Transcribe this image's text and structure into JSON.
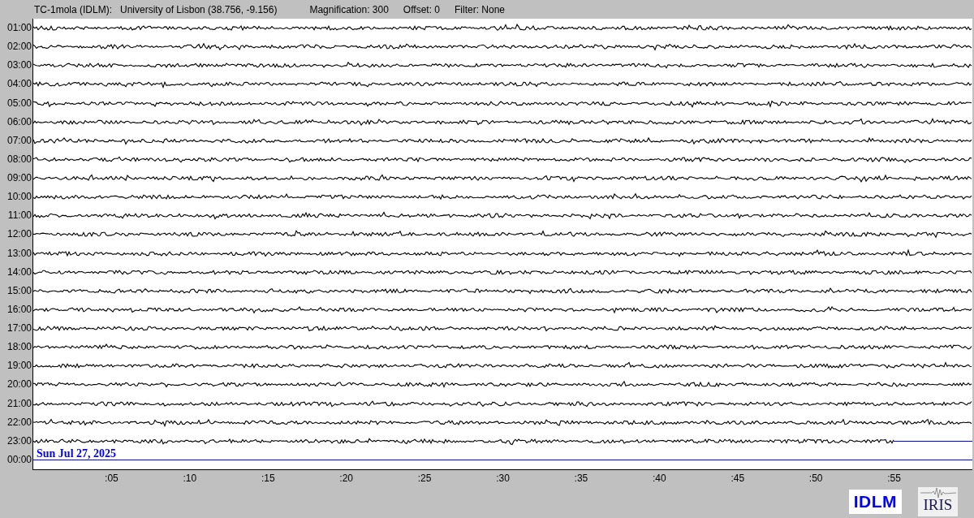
{
  "header": {
    "station": "TC-1mola (IDLM):",
    "location": "University of Lisbon (38.756, -9.156)",
    "magnification": "Magnification: 300",
    "offset": "Offset: 0",
    "filter": "Filter: None"
  },
  "rows": [
    {
      "label": "01:00",
      "kind": "full"
    },
    {
      "label": "02:00",
      "kind": "full"
    },
    {
      "label": "03:00",
      "kind": "full"
    },
    {
      "label": "04:00",
      "kind": "full"
    },
    {
      "label": "05:00",
      "kind": "full"
    },
    {
      "label": "06:00",
      "kind": "full"
    },
    {
      "label": "07:00",
      "kind": "full"
    },
    {
      "label": "08:00",
      "kind": "full"
    },
    {
      "label": "09:00",
      "kind": "full"
    },
    {
      "label": "10:00",
      "kind": "full"
    },
    {
      "label": "11:00",
      "kind": "full"
    },
    {
      "label": "12:00",
      "kind": "full"
    },
    {
      "label": "13:00",
      "kind": "full"
    },
    {
      "label": "14:00",
      "kind": "full"
    },
    {
      "label": "15:00",
      "kind": "full"
    },
    {
      "label": "16:00",
      "kind": "full"
    },
    {
      "label": "17:00",
      "kind": "full"
    },
    {
      "label": "18:00",
      "kind": "full"
    },
    {
      "label": "19:00",
      "kind": "full"
    },
    {
      "label": "20:00",
      "kind": "full"
    },
    {
      "label": "21:00",
      "kind": "full"
    },
    {
      "label": "22:00",
      "kind": "full"
    },
    {
      "label": "23:00",
      "kind": "partial"
    },
    {
      "label": "00:00",
      "kind": "empty"
    }
  ],
  "date_label": "Sun Jul 27, 2025",
  "x_ticks": [
    ":05",
    ":10",
    ":15",
    ":20",
    ":25",
    ":30",
    ":35",
    ":40",
    ":45",
    ":50",
    ":55"
  ],
  "logos": {
    "station": "IDLM",
    "network": "IRIS"
  }
}
